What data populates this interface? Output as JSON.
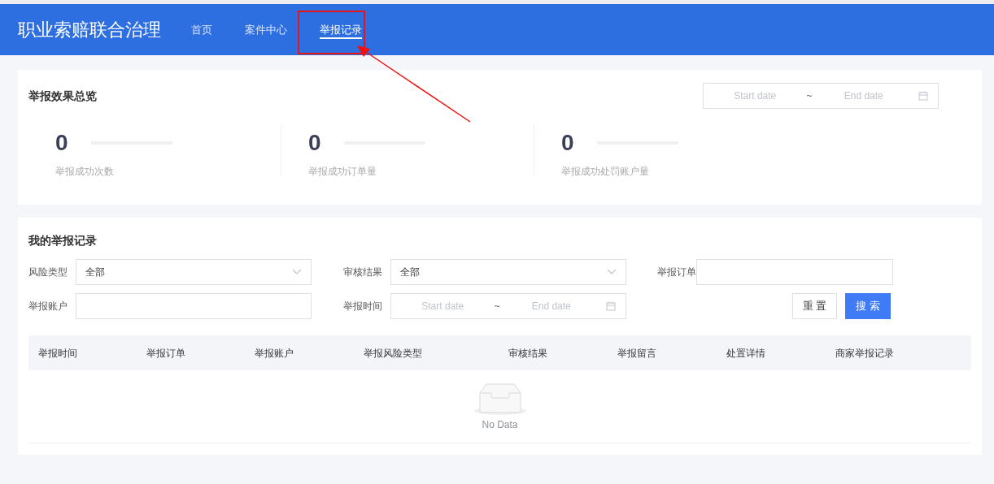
{
  "header": {
    "title": "职业索赔联合治理",
    "nav": [
      {
        "label": "首页",
        "selected": false
      },
      {
        "label": "案件中心",
        "selected": false
      },
      {
        "label": "举报记录",
        "selected": true
      }
    ]
  },
  "summary": {
    "title": "举报效果总览",
    "date_range": {
      "start_placeholder": "Start date",
      "separator": "~",
      "end_placeholder": "End date"
    },
    "stats": [
      {
        "value": "0",
        "label": "举报成功次数",
        "level": 0
      },
      {
        "value": "0",
        "label": "举报成功订单量",
        "level": 0
      },
      {
        "value": "0",
        "label": "举报成功处罚账户量",
        "level": 0
      }
    ]
  },
  "records": {
    "title": "我的举报记录",
    "filters": [
      {
        "kind": "select",
        "label": "风险类型",
        "value": "全部"
      },
      {
        "kind": "select",
        "label": "审核结果",
        "value": "全部"
      },
      {
        "kind": "input",
        "label": "举报订单"
      },
      {
        "kind": "input",
        "label": "举报账户"
      },
      {
        "kind": "daterange",
        "label": "举报时间",
        "start_placeholder": "Start date",
        "separator": "~",
        "end_placeholder": "End date"
      }
    ],
    "buttons": [
      {
        "label": "重 置",
        "kind": "default"
      },
      {
        "label": "搜 索",
        "kind": "primary"
      }
    ],
    "table": {
      "columns": [
        "举报时间",
        "举报订单",
        "举报账户",
        "举报风险类型",
        "审核结果",
        "举报留言",
        "处置详情",
        "商家举报记录"
      ],
      "empty_text": "No Data"
    }
  }
}
